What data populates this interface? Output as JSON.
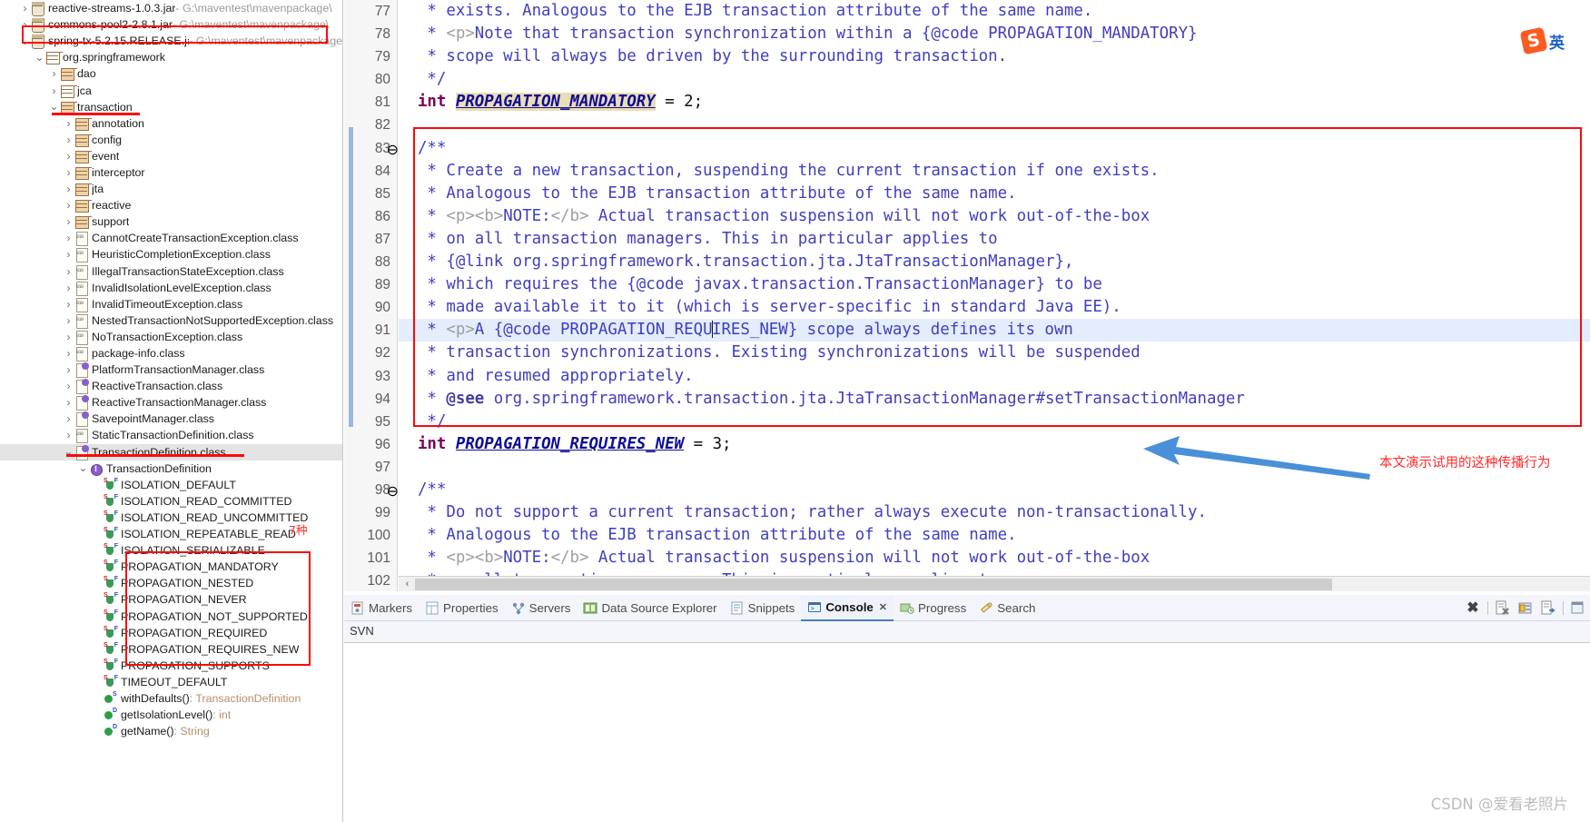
{
  "explorer": {
    "rows": [
      {
        "indent": 1,
        "twisty": "collapsed",
        "icon": "jar-icon",
        "label": "reactive-streams-1.0.3.jar",
        "path": " - G:\\maventest\\mavenpackage\\",
        "kind": "jar"
      },
      {
        "indent": 1,
        "twisty": "collapsed",
        "icon": "jar-icon",
        "label": "commons-pool2-2.8.1.jar",
        "path": " - G:\\maventest\\mavenpackage\\",
        "kind": "jar"
      },
      {
        "indent": 1,
        "twisty": "expanded",
        "icon": "jar-icon",
        "label": "spring-tx-5.2.15.RELEASE.jar",
        "path": " - G:\\maventest\\mavenpackage",
        "kind": "jar"
      },
      {
        "indent": 2,
        "twisty": "expanded",
        "icon": "package-icon",
        "label": "org.springframework",
        "path": "",
        "kind": "pkg-plain"
      },
      {
        "indent": 3,
        "twisty": "collapsed",
        "icon": "package-icon",
        "label": "dao",
        "path": "",
        "kind": "pkg"
      },
      {
        "indent": 3,
        "twisty": "collapsed",
        "icon": "package-icon",
        "label": "jca",
        "path": "",
        "kind": "pkg-plain"
      },
      {
        "indent": 3,
        "twisty": "expanded",
        "icon": "package-icon",
        "label": "transaction",
        "path": "",
        "kind": "pkg"
      },
      {
        "indent": 4,
        "twisty": "collapsed",
        "icon": "package-icon",
        "label": "annotation",
        "path": "",
        "kind": "pkg"
      },
      {
        "indent": 4,
        "twisty": "collapsed",
        "icon": "package-icon",
        "label": "config",
        "path": "",
        "kind": "pkg"
      },
      {
        "indent": 4,
        "twisty": "collapsed",
        "icon": "package-icon",
        "label": "event",
        "path": "",
        "kind": "pkg"
      },
      {
        "indent": 4,
        "twisty": "collapsed",
        "icon": "package-icon",
        "label": "interceptor",
        "path": "",
        "kind": "pkg"
      },
      {
        "indent": 4,
        "twisty": "collapsed",
        "icon": "package-icon",
        "label": "jta",
        "path": "",
        "kind": "pkg"
      },
      {
        "indent": 4,
        "twisty": "collapsed",
        "icon": "package-icon",
        "label": "reactive",
        "path": "",
        "kind": "pkg"
      },
      {
        "indent": 4,
        "twisty": "collapsed",
        "icon": "package-icon",
        "label": "support",
        "path": "",
        "kind": "pkg"
      },
      {
        "indent": 4,
        "twisty": "collapsed",
        "icon": "class-file-icon",
        "label": "CannotCreateTransactionException.class",
        "path": "",
        "kind": "class"
      },
      {
        "indent": 4,
        "twisty": "collapsed",
        "icon": "class-file-icon",
        "label": "HeuristicCompletionException.class",
        "path": "",
        "kind": "class"
      },
      {
        "indent": 4,
        "twisty": "collapsed",
        "icon": "class-file-icon",
        "label": "IllegalTransactionStateException.class",
        "path": "",
        "kind": "class"
      },
      {
        "indent": 4,
        "twisty": "collapsed",
        "icon": "class-file-icon",
        "label": "InvalidIsolationLevelException.class",
        "path": "",
        "kind": "class"
      },
      {
        "indent": 4,
        "twisty": "collapsed",
        "icon": "class-file-icon",
        "label": "InvalidTimeoutException.class",
        "path": "",
        "kind": "class"
      },
      {
        "indent": 4,
        "twisty": "collapsed",
        "icon": "class-file-icon",
        "label": "NestedTransactionNotSupportedException.class",
        "path": "",
        "kind": "class"
      },
      {
        "indent": 4,
        "twisty": "collapsed",
        "icon": "class-file-icon",
        "label": "NoTransactionException.class",
        "path": "",
        "kind": "class"
      },
      {
        "indent": 4,
        "twisty": "collapsed",
        "icon": "class-file-icon",
        "label": "package-info.class",
        "path": "",
        "kind": "class"
      },
      {
        "indent": 4,
        "twisty": "collapsed",
        "icon": "interface-file-icon",
        "label": "PlatformTransactionManager.class",
        "path": "",
        "kind": "iface"
      },
      {
        "indent": 4,
        "twisty": "collapsed",
        "icon": "interface-file-icon",
        "label": "ReactiveTransaction.class",
        "path": "",
        "kind": "iface"
      },
      {
        "indent": 4,
        "twisty": "collapsed",
        "icon": "interface-file-icon",
        "label": "ReactiveTransactionManager.class",
        "path": "",
        "kind": "iface"
      },
      {
        "indent": 4,
        "twisty": "collapsed",
        "icon": "interface-file-icon",
        "label": "SavepointManager.class",
        "path": "",
        "kind": "iface"
      },
      {
        "indent": 4,
        "twisty": "collapsed",
        "icon": "class-file-icon",
        "label": "StaticTransactionDefinition.class",
        "path": "",
        "kind": "class"
      },
      {
        "indent": 4,
        "twisty": "expanded",
        "icon": "interface-file-icon",
        "label": "TransactionDefinition.class",
        "path": "",
        "kind": "iface",
        "selected": true
      },
      {
        "indent": 5,
        "twisty": "expanded",
        "icon": "interface-type-icon",
        "label": "TransactionDefinition",
        "path": "",
        "kind": "itype"
      },
      {
        "indent": 6,
        "twisty": "none",
        "icon": "static-final-field-icon",
        "label": "ISOLATION_DEFAULT",
        "path": "",
        "kind": "field"
      },
      {
        "indent": 6,
        "twisty": "none",
        "icon": "static-final-field-icon",
        "label": "ISOLATION_READ_COMMITTED",
        "path": "",
        "kind": "field"
      },
      {
        "indent": 6,
        "twisty": "none",
        "icon": "static-final-field-icon",
        "label": "ISOLATION_READ_UNCOMMITTED",
        "path": "",
        "kind": "field"
      },
      {
        "indent": 6,
        "twisty": "none",
        "icon": "static-final-field-icon",
        "label": "ISOLATION_REPEATABLE_READ",
        "path": "",
        "kind": "field"
      },
      {
        "indent": 6,
        "twisty": "none",
        "icon": "static-final-field-icon",
        "label": "ISOLATION_SERIALIZABLE",
        "path": "",
        "kind": "field"
      },
      {
        "indent": 6,
        "twisty": "none",
        "icon": "static-final-field-icon",
        "label": "PROPAGATION_MANDATORY",
        "path": "",
        "kind": "field"
      },
      {
        "indent": 6,
        "twisty": "none",
        "icon": "static-final-field-icon",
        "label": "PROPAGATION_NESTED",
        "path": "",
        "kind": "field"
      },
      {
        "indent": 6,
        "twisty": "none",
        "icon": "static-final-field-icon",
        "label": "PROPAGATION_NEVER",
        "path": "",
        "kind": "field"
      },
      {
        "indent": 6,
        "twisty": "none",
        "icon": "static-final-field-icon",
        "label": "PROPAGATION_NOT_SUPPORTED",
        "path": "",
        "kind": "field"
      },
      {
        "indent": 6,
        "twisty": "none",
        "icon": "static-final-field-icon",
        "label": "PROPAGATION_REQUIRED",
        "path": "",
        "kind": "field"
      },
      {
        "indent": 6,
        "twisty": "none",
        "icon": "static-final-field-icon",
        "label": "PROPAGATION_REQUIRES_NEW",
        "path": "",
        "kind": "field"
      },
      {
        "indent": 6,
        "twisty": "none",
        "icon": "static-final-field-icon",
        "label": "PROPAGATION_SUPPORTS",
        "path": "",
        "kind": "field"
      },
      {
        "indent": 6,
        "twisty": "none",
        "icon": "static-final-field-icon",
        "label": "TIMEOUT_DEFAULT",
        "path": "",
        "kind": "field"
      },
      {
        "indent": 6,
        "twisty": "none",
        "icon": "static-method-icon",
        "label": "withDefaults()",
        "ret": " : TransactionDefinition",
        "path": "",
        "kind": "method"
      },
      {
        "indent": 6,
        "twisty": "none",
        "icon": "default-method-icon",
        "label": "getIsolationLevel()",
        "ret": " : int",
        "path": "",
        "kind": "method"
      },
      {
        "indent": 6,
        "twisty": "none",
        "icon": "default-method-icon",
        "label": "getName()",
        "ret": " : String",
        "path": "",
        "kind": "method"
      }
    ],
    "annotations": {
      "seven_kinds_label": "7种"
    }
  },
  "editor": {
    "lines": [
      {
        "num": "77",
        "fold": "",
        "segs": [
          {
            "t": "   ",
            "c": "plain"
          },
          {
            "t": "* exists. Analogous to the EJB transaction attribute of the same name.",
            "c": "cm"
          }
        ]
      },
      {
        "num": "78",
        "fold": "",
        "segs": [
          {
            "t": "   ",
            "c": "plain"
          },
          {
            "t": "* ",
            "c": "cm"
          },
          {
            "t": "<p>",
            "c": "tag"
          },
          {
            "t": "Note that transaction synchronization within a {@code PROPAGATION_MANDATORY}",
            "c": "cm"
          }
        ]
      },
      {
        "num": "79",
        "fold": "",
        "segs": [
          {
            "t": "   ",
            "c": "plain"
          },
          {
            "t": "* scope will always be driven by the surrounding transaction.",
            "c": "cm"
          }
        ]
      },
      {
        "num": "80",
        "fold": "",
        "segs": [
          {
            "t": "   ",
            "c": "plain"
          },
          {
            "t": "*/",
            "c": "cm"
          }
        ]
      },
      {
        "num": "81",
        "fold": "",
        "segs": [
          {
            "t": "  ",
            "c": "plain"
          },
          {
            "t": "int",
            "c": "kw"
          },
          {
            "t": " ",
            "c": "plain"
          },
          {
            "t": "PROPAGATION_MANDATORY",
            "c": "fld fld-hl"
          },
          {
            "t": " = ",
            "c": "plain"
          },
          {
            "t": "2",
            "c": "num"
          },
          {
            "t": ";",
            "c": "plain"
          }
        ]
      },
      {
        "num": "82",
        "fold": "",
        "segs": []
      },
      {
        "num": "83",
        "fold": "⊖",
        "segs": [
          {
            "t": "  ",
            "c": "plain"
          },
          {
            "t": "/**",
            "c": "cm"
          }
        ]
      },
      {
        "num": "84",
        "fold": "",
        "segs": [
          {
            "t": "   ",
            "c": "plain"
          },
          {
            "t": "* Create a new transaction, suspending the current transaction if one exists.",
            "c": "cm"
          }
        ]
      },
      {
        "num": "85",
        "fold": "",
        "segs": [
          {
            "t": "   ",
            "c": "plain"
          },
          {
            "t": "* Analogous to the EJB transaction attribute of the same name.",
            "c": "cm"
          }
        ]
      },
      {
        "num": "86",
        "fold": "",
        "segs": [
          {
            "t": "   ",
            "c": "plain"
          },
          {
            "t": "* ",
            "c": "cm"
          },
          {
            "t": "<p><b>",
            "c": "tag"
          },
          {
            "t": "NOTE:",
            "c": "cm"
          },
          {
            "t": "</b>",
            "c": "tag"
          },
          {
            "t": " Actual transaction suspension will not work out-of-the-box",
            "c": "cm"
          }
        ]
      },
      {
        "num": "87",
        "fold": "",
        "segs": [
          {
            "t": "   ",
            "c": "plain"
          },
          {
            "t": "* on all transaction managers. This in particular applies to",
            "c": "cm"
          }
        ]
      },
      {
        "num": "88",
        "fold": "",
        "segs": [
          {
            "t": "   ",
            "c": "plain"
          },
          {
            "t": "* {@link org.springframework.transaction.jta.JtaTransactionManager},",
            "c": "cm"
          }
        ]
      },
      {
        "num": "89",
        "fold": "",
        "segs": [
          {
            "t": "   ",
            "c": "plain"
          },
          {
            "t": "* which requires the {@code javax.transaction.TransactionManager} to be",
            "c": "cm"
          }
        ]
      },
      {
        "num": "90",
        "fold": "",
        "segs": [
          {
            "t": "   ",
            "c": "plain"
          },
          {
            "t": "* made available it to it (which is server-specific in standard Java EE).",
            "c": "cm"
          }
        ]
      },
      {
        "num": "91",
        "fold": "",
        "highlight": true,
        "segs": [
          {
            "t": "   ",
            "c": "plain"
          },
          {
            "t": "* ",
            "c": "cm"
          },
          {
            "t": "<p>",
            "c": "tag"
          },
          {
            "t": "A {@code PROPAGATION_REQU",
            "c": "cm"
          },
          {
            "t": "|CARET|",
            "c": "caret"
          },
          {
            "t": "IRES_NEW} scope always defines its own",
            "c": "cm"
          }
        ]
      },
      {
        "num": "92",
        "fold": "",
        "segs": [
          {
            "t": "   ",
            "c": "plain"
          },
          {
            "t": "* transaction synchronizations. Existing synchronizations will be suspended",
            "c": "cm"
          }
        ]
      },
      {
        "num": "93",
        "fold": "",
        "segs": [
          {
            "t": "   ",
            "c": "plain"
          },
          {
            "t": "* and resumed appropriately.",
            "c": "cm"
          }
        ]
      },
      {
        "num": "94",
        "fold": "",
        "segs": [
          {
            "t": "   ",
            "c": "plain"
          },
          {
            "t": "* ",
            "c": "cm"
          },
          {
            "t": "@see",
            "c": "jd-kw"
          },
          {
            "t": " org.springframework.transaction.jta.JtaTransactionManager#setTransactionManager",
            "c": "cm"
          }
        ]
      },
      {
        "num": "95",
        "fold": "",
        "segs": [
          {
            "t": "   ",
            "c": "plain"
          },
          {
            "t": "*/",
            "c": "cm"
          }
        ]
      },
      {
        "num": "96",
        "fold": "",
        "segs": [
          {
            "t": "  ",
            "c": "plain"
          },
          {
            "t": "int",
            "c": "kw"
          },
          {
            "t": " ",
            "c": "plain"
          },
          {
            "t": "PROPAGATION_REQUIRES_NEW",
            "c": "fld"
          },
          {
            "t": " = ",
            "c": "plain"
          },
          {
            "t": "3",
            "c": "num"
          },
          {
            "t": ";",
            "c": "plain"
          }
        ]
      },
      {
        "num": "97",
        "fold": "",
        "segs": []
      },
      {
        "num": "98",
        "fold": "⊖",
        "segs": [
          {
            "t": "  ",
            "c": "plain"
          },
          {
            "t": "/**",
            "c": "cm"
          }
        ]
      },
      {
        "num": "99",
        "fold": "",
        "segs": [
          {
            "t": "   ",
            "c": "plain"
          },
          {
            "t": "* Do not support a current transaction; rather always execute non-transactionally.",
            "c": "cm"
          }
        ]
      },
      {
        "num": "100",
        "fold": "",
        "segs": [
          {
            "t": "   ",
            "c": "plain"
          },
          {
            "t": "* Analogous to the EJB transaction attribute of the same name.",
            "c": "cm"
          }
        ]
      },
      {
        "num": "101",
        "fold": "",
        "segs": [
          {
            "t": "   ",
            "c": "plain"
          },
          {
            "t": "* ",
            "c": "cm"
          },
          {
            "t": "<p><b>",
            "c": "tag"
          },
          {
            "t": "NOTE:",
            "c": "cm"
          },
          {
            "t": "</b>",
            "c": "tag"
          },
          {
            "t": " Actual transaction suspension will not work out-of-the-box",
            "c": "cm"
          }
        ]
      },
      {
        "num": "102",
        "fold": "",
        "segs": [
          {
            "t": "   ",
            "c": "plain"
          },
          {
            "t": "* on all transaction managers. This in particular applies to",
            "c": "cm"
          }
        ]
      }
    ],
    "annotation_text": "本文演示试用的这种传播行为",
    "scroll_left_arrow": "‹"
  },
  "bottom_panel": {
    "tabs": [
      {
        "label": "Markers",
        "icon": "markers-icon",
        "active": false
      },
      {
        "label": "Properties",
        "icon": "properties-icon",
        "active": false
      },
      {
        "label": "Servers",
        "icon": "servers-icon",
        "active": false
      },
      {
        "label": "Data Source Explorer",
        "icon": "data-source-icon",
        "active": false
      },
      {
        "label": "Snippets",
        "icon": "snippets-icon",
        "active": false
      },
      {
        "label": "Console",
        "icon": "console-icon",
        "active": true,
        "close": "✕"
      },
      {
        "label": "Progress",
        "icon": "progress-icon",
        "active": false
      },
      {
        "label": "Search",
        "icon": "search-icon",
        "active": false
      }
    ],
    "console_label": "SVN",
    "toolbar_icons": [
      "terminate-all-icon",
      "clear-console-icon",
      "lock-scroll-icon",
      "show-console-icon",
      "open-console-icon"
    ]
  },
  "ime": {
    "logo": "S",
    "mode": "英"
  },
  "watermark": "CSDN @爱看老照片",
  "colors": {
    "annotation_red": "#fb0a0a",
    "annotation_text_red": "#ff2a2a",
    "arrow_blue": "#4a90d9",
    "comment_blue": "#3f3fbf",
    "keyword_purple": "#7f0055",
    "highlight_tan": "#ebddb5",
    "line_highlight": "#e3edfb"
  }
}
